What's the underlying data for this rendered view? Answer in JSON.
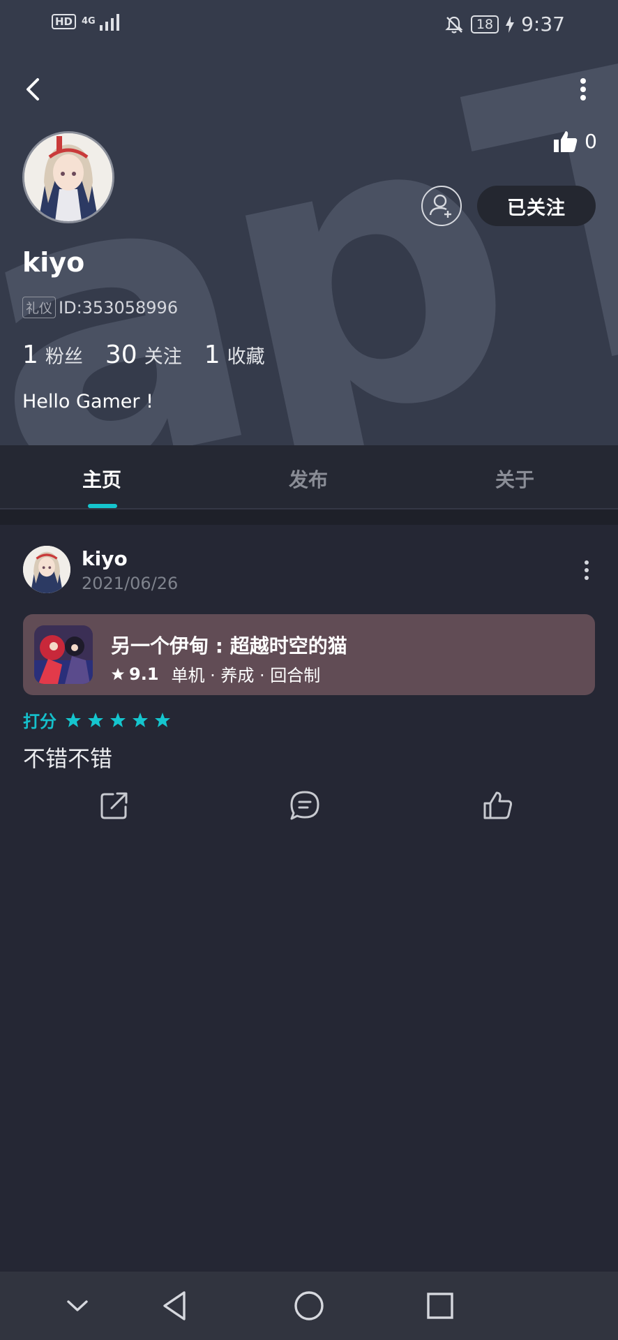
{
  "status_bar": {
    "hd": "HD",
    "network": "4G",
    "battery": "18",
    "time": "9:37"
  },
  "profile": {
    "username": "kiyo",
    "tag": "礼仪",
    "id_text": "ID:353058996",
    "likes": "0",
    "follow_button": "已关注",
    "stats": [
      {
        "num": "1",
        "label": "粉丝"
      },
      {
        "num": "30",
        "label": "关注"
      },
      {
        "num": "1",
        "label": "收藏"
      }
    ],
    "bio": "Hello Gamer !",
    "watermark": "apTap"
  },
  "tabs": [
    {
      "label": "主页",
      "active": true
    },
    {
      "label": "发布",
      "active": false
    },
    {
      "label": "关于",
      "active": false
    }
  ],
  "post": {
    "username": "kiyo",
    "date": "2021/06/26",
    "game": {
      "title": "另一个伊甸 : 超越时空的猫",
      "rating": "9.1",
      "tags": [
        "单机",
        "养成",
        "回合制"
      ],
      "tags_sep": " · "
    },
    "rating_label": "打分",
    "stars": 5,
    "review": "不错不错"
  },
  "colors": {
    "accent": "#15c5ce",
    "header_bg": "#353b4b",
    "page_bg": "#252734",
    "card_bg": "#614c55"
  }
}
